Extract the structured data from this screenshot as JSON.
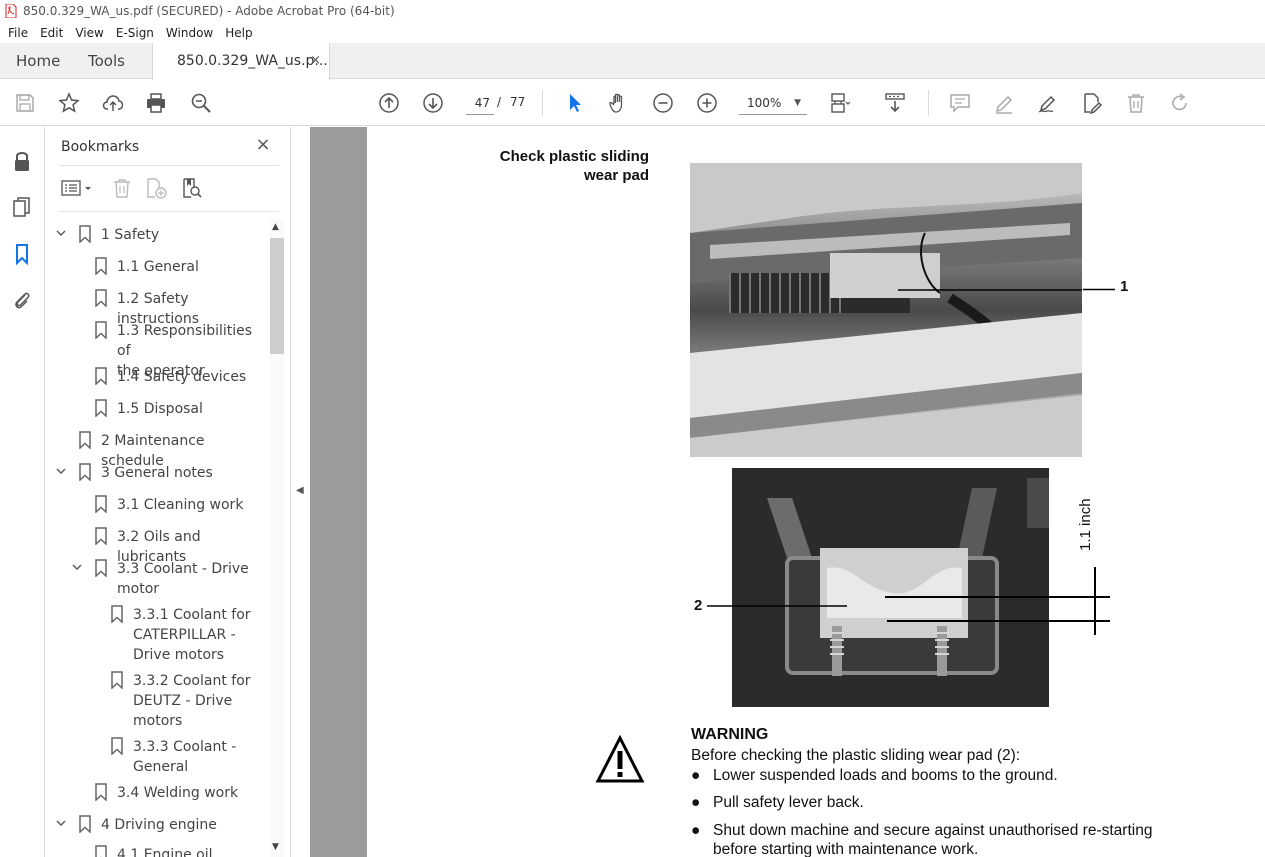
{
  "window": {
    "title": "850.0.329_WA_us.pdf (SECURED) - Adobe Acrobat Pro (64-bit)"
  },
  "menu": [
    "File",
    "Edit",
    "View",
    "E-Sign",
    "Window",
    "Help"
  ],
  "tabs": {
    "home": "Home",
    "tools": "Tools",
    "document": "850.0.329_WA_us.p...",
    "document_close": "×"
  },
  "toolbar": {
    "current_page": "47",
    "page_separator": "/",
    "total_pages": "77",
    "zoom": "100%"
  },
  "bookmarks": {
    "title": "Bookmarks",
    "close": "×",
    "items": [
      {
        "label": "1 Safety",
        "expand": "open"
      },
      {
        "label": "1.1 General",
        "expand": "none"
      },
      {
        "label": "1.2 Safety instructions",
        "expand": "none"
      },
      {
        "label": "1.3 Responsibilities of",
        "label2": "the operator",
        "expand": "none"
      },
      {
        "label": "1.4 Safety devices",
        "expand": "none"
      },
      {
        "label": "1.5 Disposal",
        "expand": "none"
      },
      {
        "label": "2 Maintenance schedule",
        "expand": "none"
      },
      {
        "label": "3 General notes",
        "expand": "open"
      },
      {
        "label": "3.1 Cleaning work",
        "expand": "none"
      },
      {
        "label": "3.2 Oils and lubricants",
        "expand": "none"
      },
      {
        "label": "3.3 Coolant - Drive",
        "label2": "motor",
        "expand": "open"
      },
      {
        "label": "3.3.1 Coolant for",
        "label2": "CATERPILLAR -",
        "label3": "Drive motors",
        "expand": "none"
      },
      {
        "label": "3.3.2 Coolant for",
        "label2": "DEUTZ - Drive",
        "label3": "motors",
        "expand": "none"
      },
      {
        "label": "3.3.3 Coolant -",
        "label2": "General",
        "expand": "none"
      },
      {
        "label": "3.4 Welding work",
        "expand": "none"
      },
      {
        "label": "4 Driving engine",
        "expand": "open"
      },
      {
        "label": "4.1 Engine oil",
        "expand": "none"
      }
    ]
  },
  "document": {
    "heading_line1": "Check plastic sliding",
    "heading_line2": "wear pad",
    "callout_1": "1",
    "callout_2": "2",
    "dimension_label": "1.1 inch",
    "warning_title": "WARNING",
    "warning_intro": "Before checking the plastic sliding wear pad (2):",
    "bullet_char": "●",
    "warning_items": [
      "Lower suspended loads and booms to the ground.",
      "Pull safety lever back.",
      "Shut down machine and secure against unauthorised re-starting",
      "before starting with maintenance work."
    ]
  },
  "colors": {
    "accent_blue": "#1473e6",
    "pdf_red": "#d9261c",
    "panel_border": "#dadada",
    "doc_background": "#9b9b9b"
  }
}
